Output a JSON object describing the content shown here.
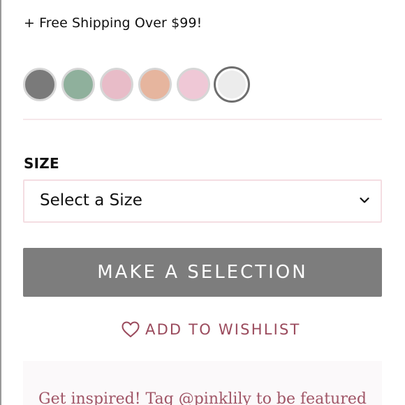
{
  "shipping": {
    "text": "+ Free Shipping Over $99!"
  },
  "swatches": [
    {
      "name": "gray",
      "color": "#7a7a7a",
      "selected": false
    },
    {
      "name": "sage",
      "color": "#8fb09c",
      "selected": false
    },
    {
      "name": "blush-pink",
      "color": "#e8bcc8",
      "selected": false
    },
    {
      "name": "peach",
      "color": "#e6b59e",
      "selected": false
    },
    {
      "name": "light-pink",
      "color": "#efc8d6",
      "selected": false
    },
    {
      "name": "white",
      "color": "#ececec",
      "selected": true
    }
  ],
  "size": {
    "label": "SIZE",
    "placeholder": "Select a Size",
    "icon": "chevron-down-icon"
  },
  "cta": {
    "label": "MAKE A SELECTION",
    "color": "#7d7d7d"
  },
  "wishlist": {
    "label": "ADD TO WISHLIST",
    "icon": "heart-icon",
    "color": "#9a4a5c"
  },
  "inspire": {
    "text": "Get inspired! Tag @pinklily to be featured"
  }
}
